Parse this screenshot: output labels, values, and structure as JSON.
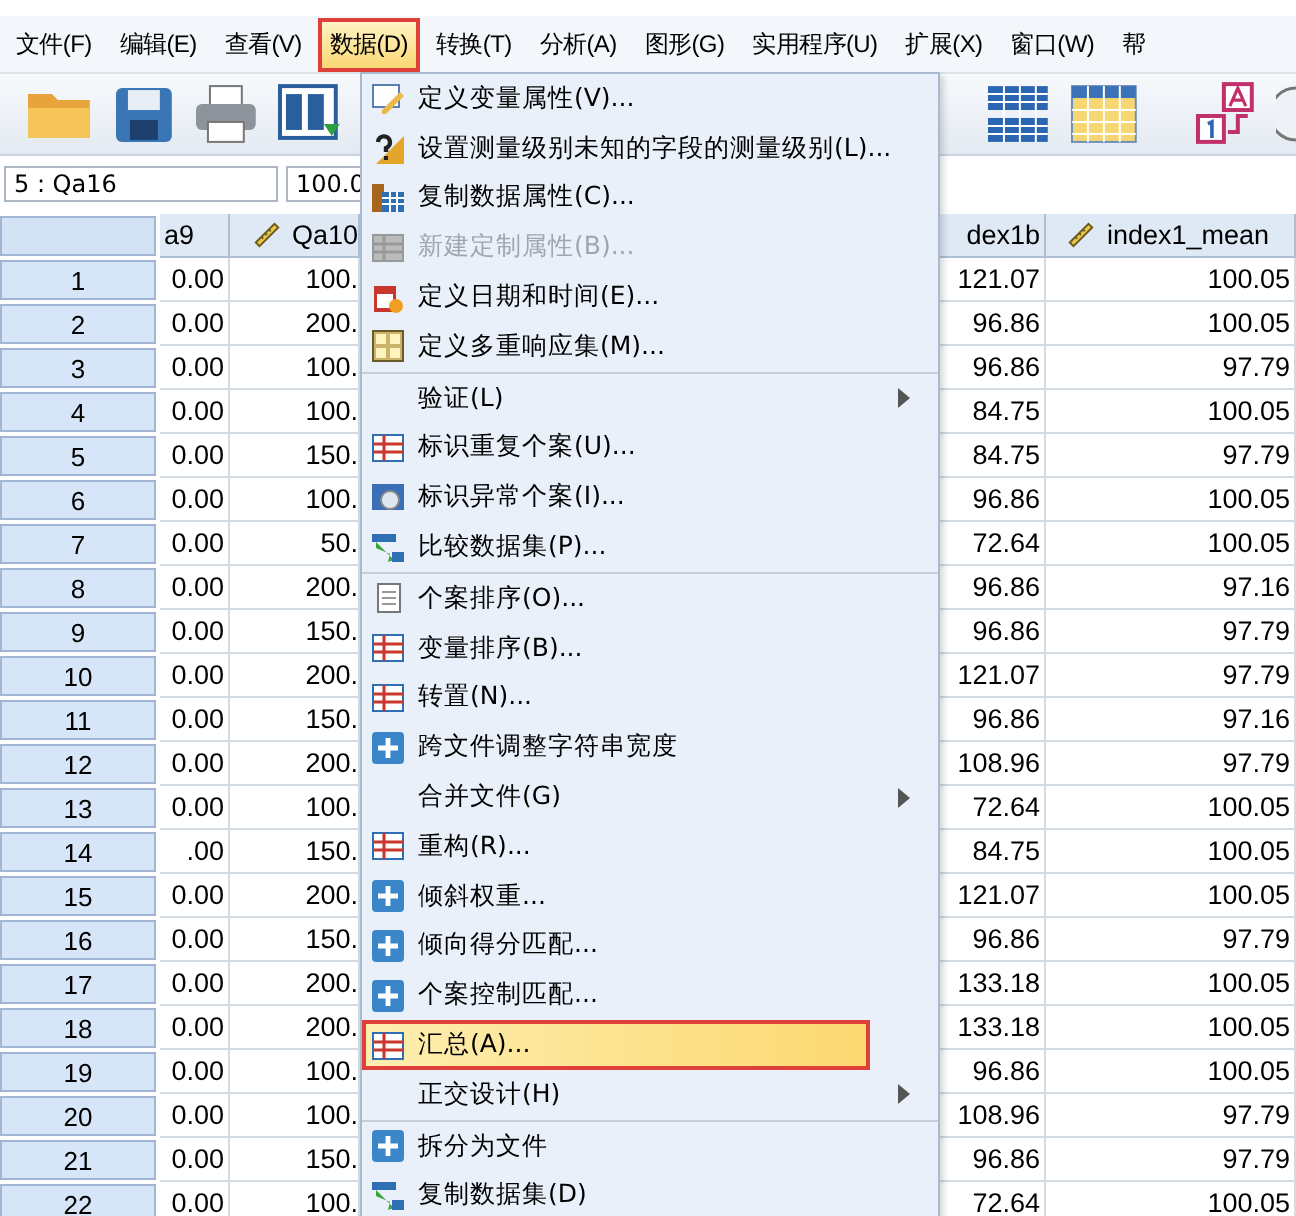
{
  "menu_bar": [
    {
      "label": "文件(F)",
      "selected": false
    },
    {
      "label": "编辑(E)",
      "selected": false
    },
    {
      "label": "查看(V)",
      "selected": false
    },
    {
      "label": "数据(D)",
      "selected": true
    },
    {
      "label": "转换(T)",
      "selected": false
    },
    {
      "label": "分析(A)",
      "selected": false
    },
    {
      "label": "图形(G)",
      "selected": false
    },
    {
      "label": "实用程序(U)",
      "selected": false
    },
    {
      "label": "扩展(X)",
      "selected": false
    },
    {
      "label": "窗口(W)",
      "selected": false
    },
    {
      "label": "帮",
      "selected": false
    }
  ],
  "cell_reference": {
    "name": "5 : Qa16",
    "value": "100.0"
  },
  "table": {
    "columns": [
      {
        "label": "a9",
        "ruler": false
      },
      {
        "label": "Qa10",
        "ruler": true
      },
      {
        "label": "dex1b",
        "ruler": false
      },
      {
        "label": "index1_mean",
        "ruler": true
      }
    ],
    "rows": [
      {
        "num": "1",
        "cells": [
          "0.00",
          "100.",
          "121.07",
          "100.05"
        ]
      },
      {
        "num": "2",
        "cells": [
          "0.00",
          "200.",
          "96.86",
          "100.05"
        ]
      },
      {
        "num": "3",
        "cells": [
          "0.00",
          "100.",
          "96.86",
          "97.79"
        ]
      },
      {
        "num": "4",
        "cells": [
          "0.00",
          "100.",
          "84.75",
          "100.05"
        ]
      },
      {
        "num": "5",
        "cells": [
          "0.00",
          "150.",
          "84.75",
          "97.79"
        ]
      },
      {
        "num": "6",
        "cells": [
          "0.00",
          "100.",
          "96.86",
          "100.05"
        ]
      },
      {
        "num": "7",
        "cells": [
          "0.00",
          "50.",
          "72.64",
          "100.05"
        ]
      },
      {
        "num": "8",
        "cells": [
          "0.00",
          "200.",
          "96.86",
          "97.16"
        ]
      },
      {
        "num": "9",
        "cells": [
          "0.00",
          "150.",
          "96.86",
          "97.79"
        ]
      },
      {
        "num": "10",
        "cells": [
          "0.00",
          "200.",
          "121.07",
          "97.79"
        ]
      },
      {
        "num": "11",
        "cells": [
          "0.00",
          "150.",
          "96.86",
          "97.16"
        ]
      },
      {
        "num": "12",
        "cells": [
          "0.00",
          "200.",
          "108.96",
          "97.79"
        ]
      },
      {
        "num": "13",
        "cells": [
          "0.00",
          "100.",
          "72.64",
          "100.05"
        ]
      },
      {
        "num": "14",
        "cells": [
          ".00",
          "150.",
          "84.75",
          "100.05"
        ]
      },
      {
        "num": "15",
        "cells": [
          "0.00",
          "200.",
          "121.07",
          "100.05"
        ]
      },
      {
        "num": "16",
        "cells": [
          "0.00",
          "150.",
          "96.86",
          "97.79"
        ]
      },
      {
        "num": "17",
        "cells": [
          "0.00",
          "200.",
          "133.18",
          "100.05"
        ]
      },
      {
        "num": "18",
        "cells": [
          "0.00",
          "200.",
          "133.18",
          "100.05"
        ]
      },
      {
        "num": "19",
        "cells": [
          "0.00",
          "100.",
          "96.86",
          "100.05"
        ]
      },
      {
        "num": "20",
        "cells": [
          "0.00",
          "100.",
          "108.96",
          "97.79"
        ]
      },
      {
        "num": "21",
        "cells": [
          "0.00",
          "150.",
          "96.86",
          "97.79"
        ]
      },
      {
        "num": "22",
        "cells": [
          "0.00",
          "100.",
          "72.64",
          "100.05"
        ]
      }
    ]
  },
  "data_menu": {
    "groups": [
      [
        {
          "label": "定义变量属性(V)...",
          "submenu": false,
          "disabled": false,
          "selected": false
        },
        {
          "label": "设置测量级别未知的字段的测量级别(L)...",
          "submenu": false,
          "disabled": false,
          "selected": false
        },
        {
          "label": "复制数据属性(C)...",
          "submenu": false,
          "disabled": false,
          "selected": false
        },
        {
          "label": "新建定制属性(B)...",
          "submenu": false,
          "disabled": true,
          "selected": false
        },
        {
          "label": "定义日期和时间(E)...",
          "submenu": false,
          "disabled": false,
          "selected": false
        },
        {
          "label": "定义多重响应集(M)...",
          "submenu": false,
          "disabled": false,
          "selected": false
        }
      ],
      [
        {
          "label": "验证(L)",
          "submenu": true,
          "disabled": false,
          "selected": false
        },
        {
          "label": "标识重复个案(U)...",
          "submenu": false,
          "disabled": false,
          "selected": false
        },
        {
          "label": "标识异常个案(I)...",
          "submenu": false,
          "disabled": false,
          "selected": false
        },
        {
          "label": "比较数据集(P)...",
          "submenu": false,
          "disabled": false,
          "selected": false
        }
      ],
      [
        {
          "label": "个案排序(O)...",
          "submenu": false,
          "disabled": false,
          "selected": false
        },
        {
          "label": "变量排序(B)...",
          "submenu": false,
          "disabled": false,
          "selected": false
        },
        {
          "label": "转置(N)...",
          "submenu": false,
          "disabled": false,
          "selected": false
        },
        {
          "label": "跨文件调整字符串宽度",
          "submenu": false,
          "disabled": false,
          "selected": false
        },
        {
          "label": "合并文件(G)",
          "submenu": true,
          "disabled": false,
          "selected": false
        },
        {
          "label": "重构(R)...",
          "submenu": false,
          "disabled": false,
          "selected": false
        },
        {
          "label": "倾斜权重...",
          "submenu": false,
          "disabled": false,
          "selected": false
        },
        {
          "label": "倾向得分匹配...",
          "submenu": false,
          "disabled": false,
          "selected": false
        },
        {
          "label": "个案控制匹配...",
          "submenu": false,
          "disabled": false,
          "selected": false
        },
        {
          "label": "汇总(A)...",
          "submenu": false,
          "disabled": false,
          "selected": true
        },
        {
          "label": "正交设计(H)",
          "submenu": true,
          "disabled": false,
          "selected": false
        }
      ],
      [
        {
          "label": "拆分为文件",
          "submenu": false,
          "disabled": false,
          "selected": false
        },
        {
          "label": "复制数据集(D)",
          "submenu": false,
          "disabled": false,
          "selected": false
        }
      ]
    ]
  }
}
